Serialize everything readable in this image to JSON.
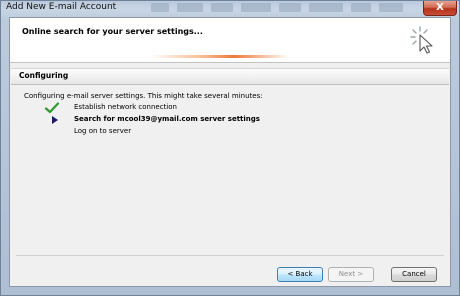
{
  "window": {
    "title": "Add New E-mail Account",
    "close_glyph": "X"
  },
  "header": {
    "title": "Online search for your server settings...",
    "icon": "cursor-click-icon"
  },
  "section": {
    "label": "Configuring"
  },
  "description": "Configuring e-mail server settings. This might take several minutes:",
  "steps": [
    {
      "status": "done",
      "icon": "checkmark-icon",
      "label": "Establish network connection"
    },
    {
      "status": "current",
      "icon": "arrow-right-icon",
      "label": "Search for mcool39@ymail.com server settings"
    },
    {
      "status": "pending",
      "icon": "",
      "label": "Log on to server"
    }
  ],
  "buttons": {
    "back": "< Back",
    "next": "Next >",
    "cancel": "Cancel"
  },
  "colors": {
    "check": "#2e9a2e",
    "arrow": "#1a1a6e",
    "close": "#c84d37"
  }
}
